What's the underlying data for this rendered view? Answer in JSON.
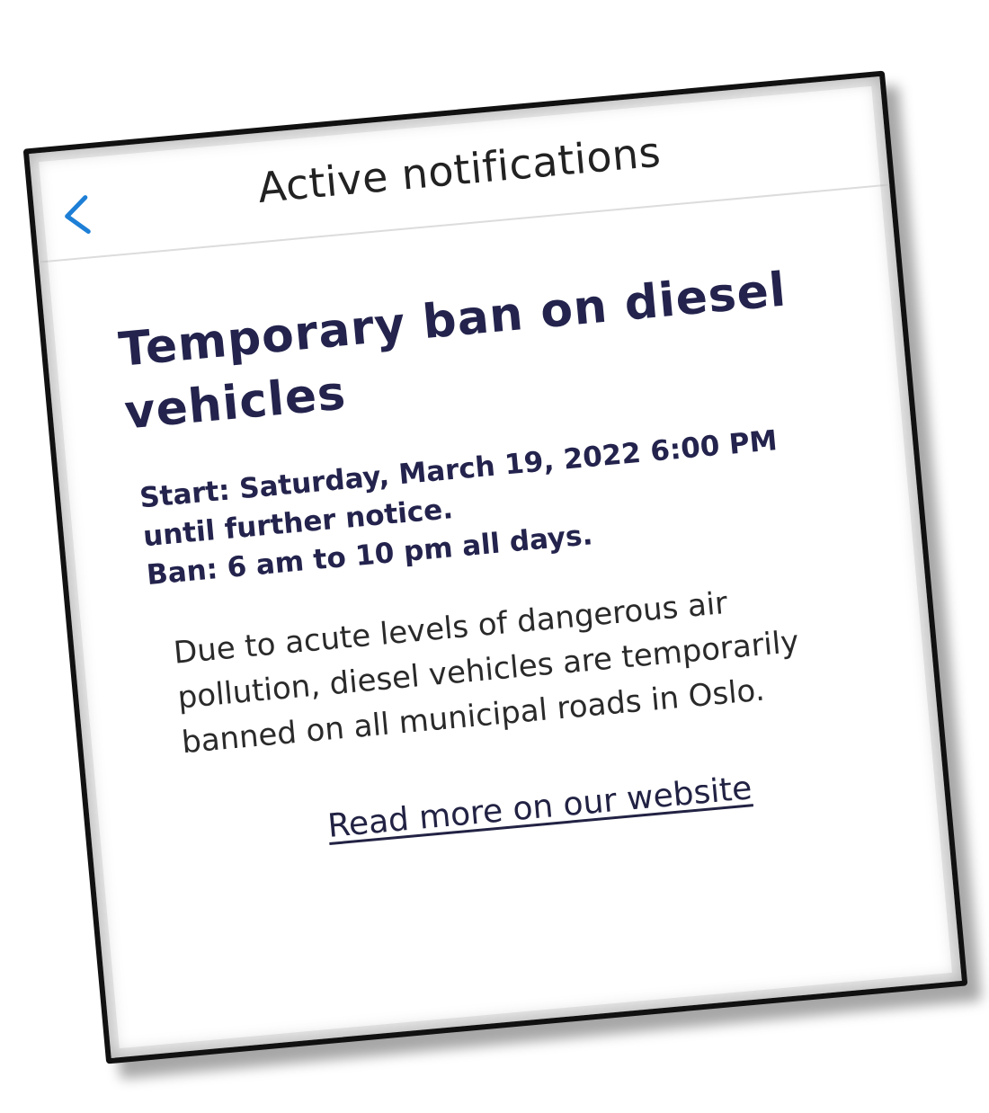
{
  "header": {
    "title": "Active notifications",
    "back_icon": "chevron-left-icon",
    "accent_color": "#1d7fd6"
  },
  "notification": {
    "title": "Temporary ban on diesel vehicles",
    "meta_lines": [
      "Start: Saturday, March 19, 2022 6:00 PM",
      "until further notice.",
      "Ban: 6 am to 10 pm all days."
    ],
    "body": "Due to acute levels of dangerous air pollution, diesel vehicles are temporarily banned on all municipal roads in Oslo.",
    "link_label": "Read more on our website",
    "title_color": "#23234d"
  }
}
